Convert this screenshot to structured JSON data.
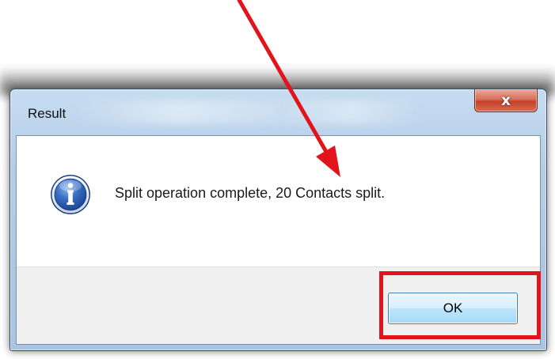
{
  "dialog": {
    "title": "Result",
    "close_label": "x",
    "message": "Split operation complete, 20 Contacts split.",
    "icon": "information-icon",
    "ok_label": "OK"
  },
  "annotations": {
    "arrow_color": "#e2131b",
    "highlight_color": "#e2131b"
  }
}
